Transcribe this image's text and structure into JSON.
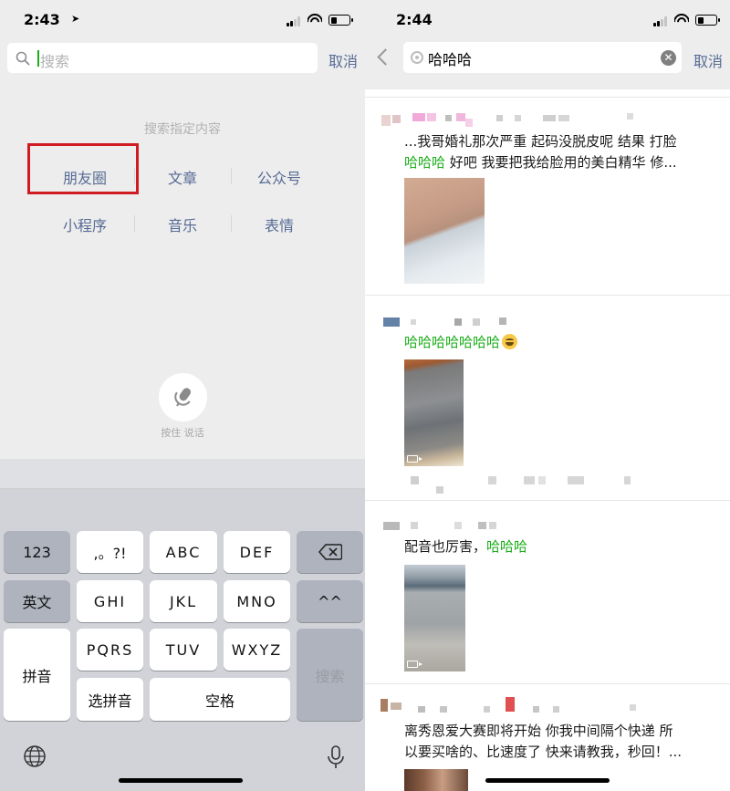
{
  "left": {
    "status": {
      "time": "2:43"
    },
    "search": {
      "placeholder": "搜索",
      "cancel": "取消"
    },
    "hint": "搜索指定内容",
    "options": [
      "朋友圈",
      "文章",
      "公众号",
      "小程序",
      "音乐",
      "表情"
    ],
    "voice": {
      "label": "按住 说话"
    },
    "keyboard": {
      "num": "123",
      "punct": ",。?!",
      "abc": "ABC",
      "def": "DEF",
      "english": "英文",
      "ghi": "GHI",
      "jkl": "JKL",
      "mno": "MNO",
      "caret": "^^",
      "pinyin": "拼音",
      "pqrs": "PQRS",
      "tuv": "TUV",
      "wxyz": "WXYZ",
      "search": "搜索",
      "select_pinyin": "选拼音",
      "space": "空格"
    }
  },
  "right": {
    "status": {
      "time": "2:44"
    },
    "search": {
      "query": "哈哈哈",
      "cancel": "取消"
    },
    "posts": [
      {
        "line1": "...我哥婚礼那次严重 起码没脱皮呢 结果 打脸",
        "kw": "哈哈哈",
        "line2": " 好吧 我要把我给脸用的美白精华 修..."
      },
      {
        "kw": "哈哈哈哈哈哈哈"
      },
      {
        "prefix": "配音也厉害，",
        "kw": "哈哈哈"
      },
      {
        "line1": "离秀恩爱大赛即将开始 你我中间隔个快递 所",
        "line2": "以要买啥的、比速度了 快来请教我，秒回！..."
      }
    ]
  },
  "colors": {
    "link": "#576b95",
    "keyword": "#1aad19",
    "highlight_box": "#cf1b21"
  }
}
